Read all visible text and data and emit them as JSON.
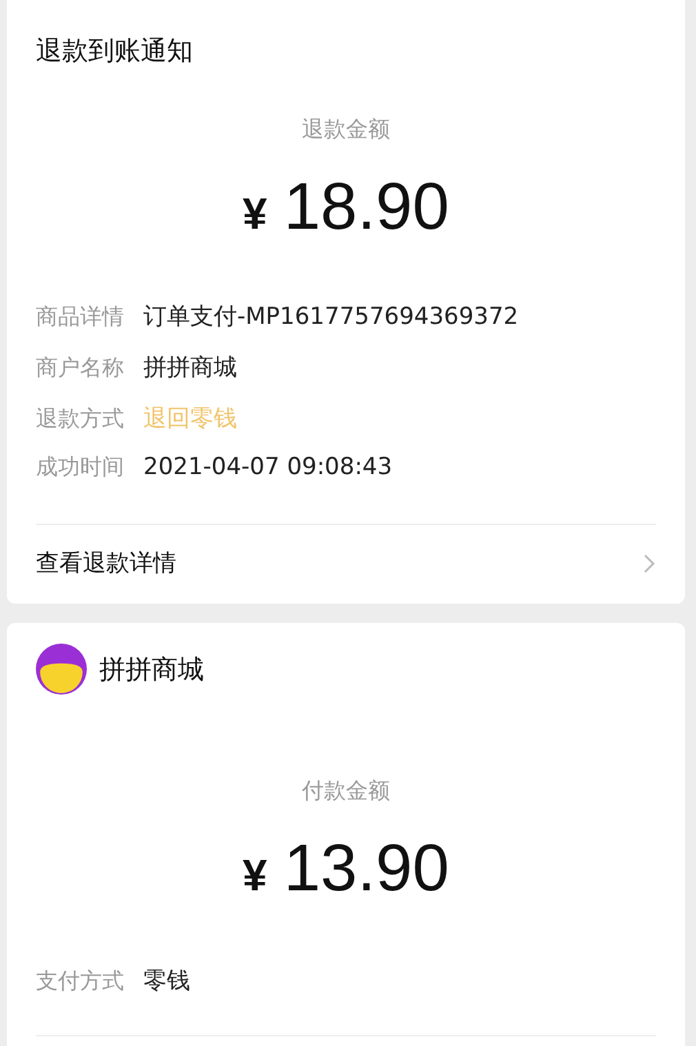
{
  "refund_card": {
    "title": "退款到账通知",
    "amount_label": "退款金额",
    "currency": "¥",
    "amount": "18.90",
    "rows": [
      {
        "label": "商品详情",
        "value": "订单支付-MP1617757694369372",
        "kind": "plain"
      },
      {
        "label": "商户名称",
        "value": "拼拼商城",
        "kind": "plain"
      },
      {
        "label": "退款方式",
        "value": "退回零钱",
        "kind": "highlight"
      },
      {
        "label": "成功时间",
        "value": "2021-04-07 09:08:43",
        "kind": "plain"
      }
    ],
    "link": "查看退款详情"
  },
  "payment_card": {
    "merchant": "拼拼商城",
    "amount_label": "付款金额",
    "currency": "¥",
    "amount": "13.90",
    "rows": [
      {
        "label": "支付方式",
        "value": "零钱",
        "kind": "plain"
      }
    ]
  }
}
